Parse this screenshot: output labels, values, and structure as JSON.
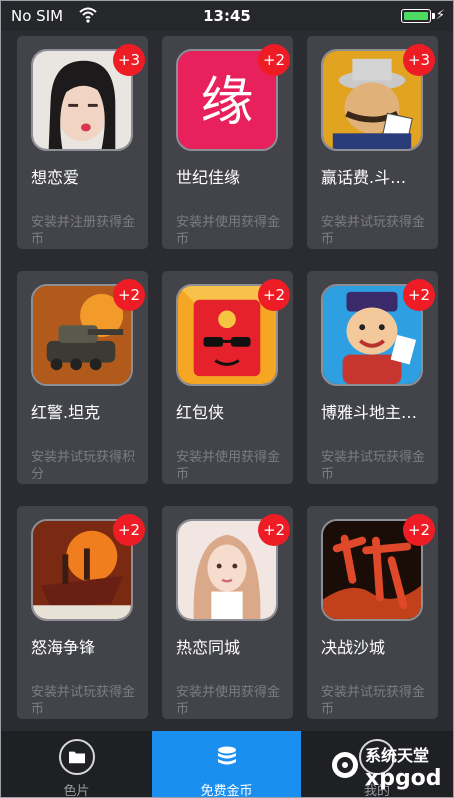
{
  "status_bar": {
    "carrier": "No SIM",
    "time": "13:45"
  },
  "apps": [
    {
      "name": "想恋爱",
      "badge": "+3",
      "desc": "安装并注册获得金币",
      "icon": "girl-portrait-icon"
    },
    {
      "name": "世纪佳缘",
      "badge": "+2",
      "desc": "安装并使用获得金币",
      "icon": "jiayuan-logo-icon"
    },
    {
      "name": "赢话费.斗…",
      "badge": "+3",
      "desc": "安装并试玩获得金币",
      "icon": "poker-man-icon"
    },
    {
      "name": "红警.坦克",
      "badge": "+2",
      "desc": "安装并试玩获得积分",
      "icon": "tank-icon"
    },
    {
      "name": "红包侠",
      "badge": "+2",
      "desc": "安装并使用获得金币",
      "icon": "red-envelope-icon"
    },
    {
      "name": "博雅斗地主…",
      "badge": "+2",
      "desc": "安装并试玩获得金币",
      "icon": "cartoon-character-icon"
    },
    {
      "name": "怒海争锋",
      "badge": "+2",
      "desc": "安装并试玩获得金币",
      "icon": "warship-icon"
    },
    {
      "name": "热恋同城",
      "badge": "+2",
      "desc": "安装并使用获得金币",
      "icon": "woman-portrait-icon"
    },
    {
      "name": "决战沙城",
      "badge": "+2",
      "desc": "安装并试玩获得金币",
      "icon": "legend-calligraphy-icon"
    }
  ],
  "tabs": [
    {
      "label": "色片",
      "icon": "folder-icon",
      "active": false
    },
    {
      "label": "免费金币",
      "icon": "coin-stack-icon",
      "active": true
    },
    {
      "label": "我的",
      "icon": "profile-icon",
      "active": false
    }
  ],
  "watermark": {
    "text_cn": "系统天堂",
    "text_en": "xpgod"
  },
  "colors": {
    "background": "#2b2c31",
    "card": "#43444a",
    "badge": "#ee1c25",
    "active_tab": "#1a8ff0"
  }
}
